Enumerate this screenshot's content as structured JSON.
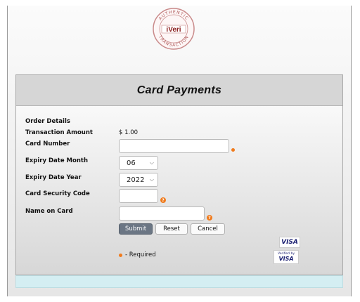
{
  "logo": {
    "top_text": "AUTHENTIC",
    "brand": "iVeri",
    "bottom_text": "TRANSACTION"
  },
  "header": {
    "title": "Card Payments"
  },
  "form": {
    "order_details_label": "Order Details",
    "transaction_amount_label": "Transaction Amount",
    "transaction_amount_value": "$ 1.00",
    "card_number_label": "Card Number",
    "card_number_value": "",
    "expiry_month_label": "Expiry Date Month",
    "expiry_month_value": "06",
    "expiry_year_label": "Expiry Date Year",
    "expiry_year_value": "2022",
    "security_code_label": "Card Security Code",
    "security_code_value": "",
    "name_on_card_label": "Name on Card",
    "name_on_card_value": "",
    "help_glyph": "?"
  },
  "buttons": {
    "submit": "Submit",
    "reset": "Reset",
    "cancel": "Cancel"
  },
  "required_note": "- Required",
  "badges": {
    "visa": "VISA",
    "verified_by": "Verified by",
    "verified_visa": "VISA"
  },
  "colors": {
    "required_accent": "#f07b1d",
    "submit_bg": "#6b7684",
    "footer_bar": "#d4eef2",
    "visa_blue": "#1a1f71"
  }
}
